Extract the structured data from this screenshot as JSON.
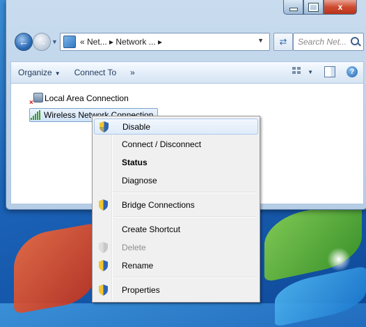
{
  "window": {
    "caption_buttons": {
      "minimize": "minimize",
      "maximize": "maximize",
      "close": "x"
    },
    "address_bar": {
      "breadcrumb": "« Net... ▸ Network ... ▸"
    },
    "search": {
      "placeholder": "Search Net..."
    }
  },
  "toolbar": {
    "organize_label": "Organize",
    "connect_to_label": "Connect To",
    "overflow_label": "»"
  },
  "connections": [
    {
      "label": "Local Area Connection",
      "icon": "lan-disconnected-icon",
      "selected": false
    },
    {
      "label": "Wireless Network Connection",
      "icon": "wifi-signal-icon",
      "selected": true
    }
  ],
  "context_menu": {
    "items": [
      {
        "label": "Disable",
        "shield": true,
        "bold": false,
        "disabled": false,
        "highlight": true
      },
      {
        "label": "Connect / Disconnect",
        "shield": false,
        "bold": false,
        "disabled": false
      },
      {
        "label": "Status",
        "shield": false,
        "bold": true,
        "disabled": false
      },
      {
        "label": "Diagnose",
        "shield": false,
        "bold": false,
        "disabled": false
      },
      {
        "label": "Bridge Connections",
        "shield": true,
        "bold": false,
        "disabled": false
      },
      {
        "label": "Create Shortcut",
        "shield": false,
        "bold": false,
        "disabled": false
      },
      {
        "label": "Delete",
        "shield": true,
        "bold": false,
        "disabled": true
      },
      {
        "label": "Rename",
        "shield": true,
        "bold": false,
        "disabled": false
      },
      {
        "label": "Properties",
        "shield": true,
        "bold": false,
        "disabled": false
      }
    ]
  },
  "colors": {
    "menu_highlight_border": "#a8c8ec",
    "window_frame": "#b6cde6",
    "close_button": "#cf4b2f"
  }
}
